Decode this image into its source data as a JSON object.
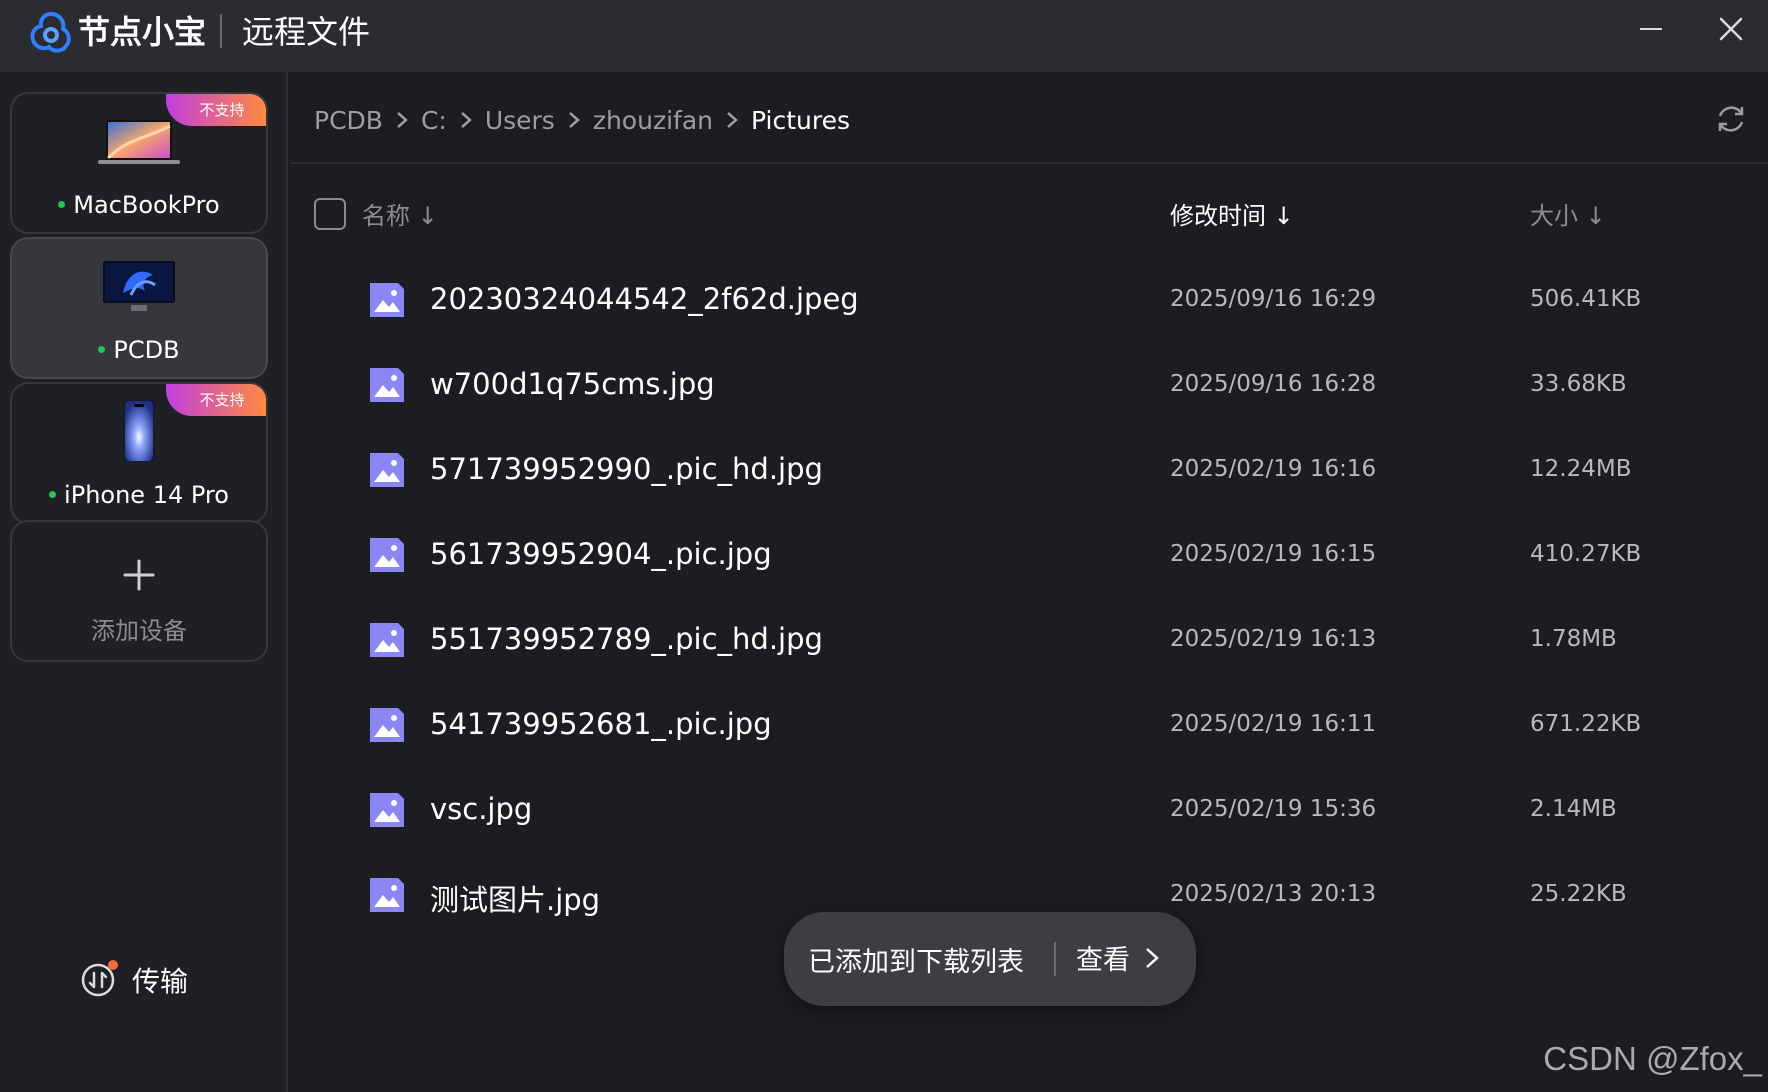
{
  "titlebar": {
    "app_name": "节点小宝",
    "page_title": "远程文件"
  },
  "sidebar": {
    "devices": [
      {
        "name": "MacBookPro",
        "status": "online",
        "badge": "不支持",
        "icon": "laptop-icon"
      },
      {
        "name": "PCDB",
        "status": "online",
        "badge": "",
        "icon": "monitor-icon"
      },
      {
        "name": "iPhone 14 Pro",
        "status": "online",
        "badge": "不支持",
        "icon": "phone-icon"
      }
    ],
    "add_device_label": "添加设备",
    "transfer_label": "传输"
  },
  "breadcrumb": [
    "PCDB",
    "C:",
    "Users",
    "zhouzifan",
    "Pictures"
  ],
  "table": {
    "columns": {
      "name": "名称 ↓",
      "modified": "修改时间 ↓",
      "size": "大小 ↓"
    },
    "rows": [
      {
        "name": "20230324044542_2f62d.jpeg",
        "modified": "2025/09/16 16:29",
        "size": "506.41KB"
      },
      {
        "name": "w700d1q75cms.jpg",
        "modified": "2025/09/16 16:28",
        "size": "33.68KB"
      },
      {
        "name": "571739952990_.pic_hd.jpg",
        "modified": "2025/02/19 16:16",
        "size": "12.24MB"
      },
      {
        "name": "561739952904_.pic.jpg",
        "modified": "2025/02/19 16:15",
        "size": "410.27KB"
      },
      {
        "name": "551739952789_.pic_hd.jpg",
        "modified": "2025/02/19 16:13",
        "size": "1.78MB"
      },
      {
        "name": "541739952681_.pic.jpg",
        "modified": "2025/02/19 16:11",
        "size": "671.22KB"
      },
      {
        "name": "vsc.jpg",
        "modified": "2025/02/19 15:36",
        "size": "2.14MB"
      },
      {
        "name": "测试图片.jpg",
        "modified": "2025/02/13 20:13",
        "size": "25.22KB"
      }
    ]
  },
  "toast": {
    "message": "已添加到下载列表",
    "action": "查看"
  },
  "watermark": "CSDN @Zfox_",
  "colors": {
    "accent": "#2f80ff",
    "online": "#22c55e",
    "badge_from": "#c13fe0",
    "badge_to": "#ff8a3d",
    "file_icon": "#8b86f5"
  }
}
